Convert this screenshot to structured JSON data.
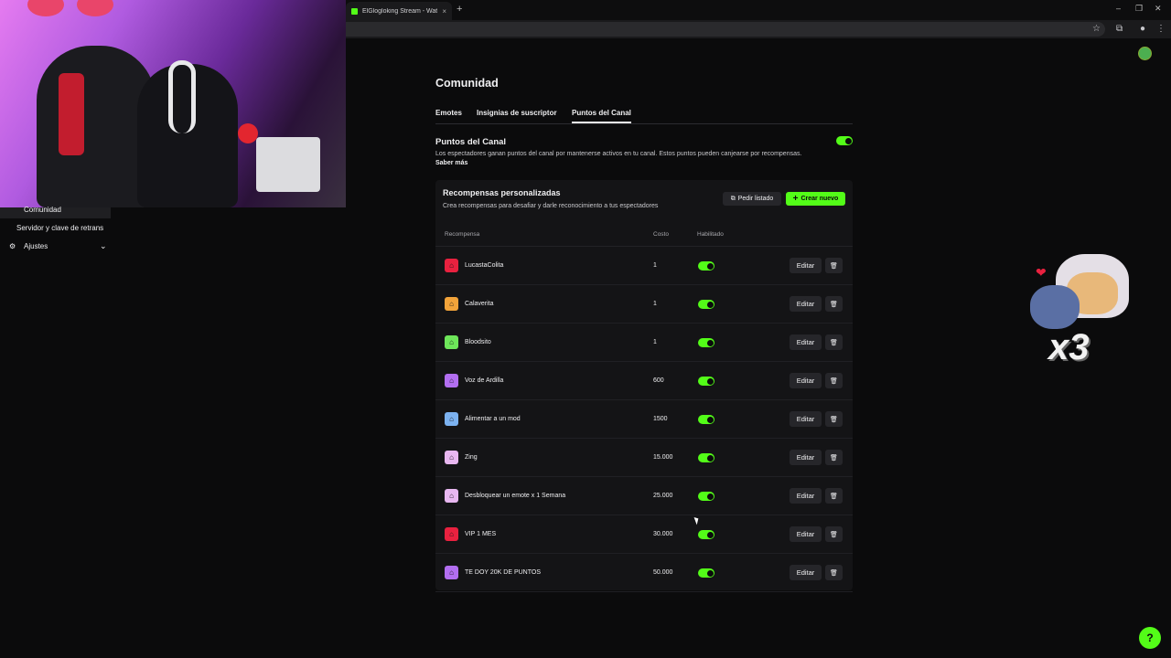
{
  "browser": {
    "tab_title": "ElGlogloking Stream - Watch Li",
    "tab_close": "×",
    "new_tab": "+",
    "window_controls": {
      "minimize": "–",
      "restore": "❐",
      "close": "✕"
    }
  },
  "sidebar": {
    "items": [
      {
        "label": "Comunidad",
        "active": true
      },
      {
        "label": "Servidor y clave de retrans"
      },
      {
        "label": "Ajustes",
        "icon": "gear-icon",
        "chevron": "chevron-down-icon"
      }
    ]
  },
  "page": {
    "title": "Comunidad",
    "tabs": [
      {
        "label": "Emotes"
      },
      {
        "label": "Insignias de suscriptor"
      },
      {
        "label": "Puntos del Canal",
        "active": true
      }
    ],
    "section": {
      "title": "Puntos del Canal",
      "description": "Los espectadores ganan puntos del canal por mantenerse activos en tu canal. Estos puntos pueden canjearse por recompensas.",
      "learn_more": "Saber más",
      "enabled": true
    }
  },
  "rewards": {
    "title": "Recompensas personalizadas",
    "subtitle": "Crea recompensas para desafiar y darle reconocimiento a tus espectadores",
    "request_list_label": "Pedir listado",
    "create_new_label": "Crear nuevo",
    "columns": {
      "reward": "Recompensa",
      "cost": "Costo",
      "enabled": "Habilitado"
    },
    "edit_label": "Editar",
    "items": [
      {
        "name": "LucastaColita",
        "cost": "1",
        "color": "#e9213f",
        "enabled": true
      },
      {
        "name": "Calaverita",
        "cost": "1",
        "color": "#f2a33a",
        "enabled": true
      },
      {
        "name": "Bloodsito",
        "cost": "1",
        "color": "#6ee65a",
        "enabled": true
      },
      {
        "name": "Voz de Ardilla",
        "cost": "600",
        "color": "#b26ef0",
        "enabled": true
      },
      {
        "name": "Alimentar a un mod",
        "cost": "1500",
        "color": "#7cb2f0",
        "enabled": true
      },
      {
        "name": "Zing",
        "cost": "15.000",
        "color": "#e8b7f0",
        "enabled": true
      },
      {
        "name": "Desbloquear un emote x 1 Semana",
        "cost": "25.000",
        "color": "#e8b7f0",
        "enabled": true
      },
      {
        "name": "VIP 1 MES",
        "cost": "30.000",
        "color": "#e9213f",
        "enabled": true
      },
      {
        "name": "TE DOY 20K DE PUNTOS",
        "cost": "50.000",
        "color": "#b26ef0",
        "enabled": true
      }
    ]
  },
  "overlay": {
    "emote_text": "x3"
  },
  "colors": {
    "accent": "#53fc18",
    "background": "#0b0b0c",
    "panel": "#141416"
  }
}
